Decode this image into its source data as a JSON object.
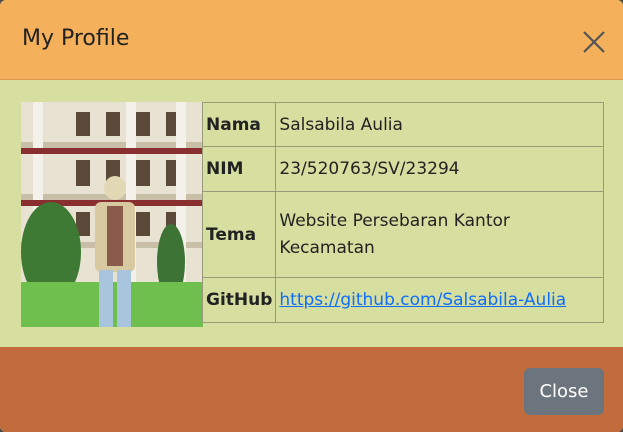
{
  "modal": {
    "title": "My Profile",
    "close_icon": "close-icon"
  },
  "profile": {
    "photo_alt": "profile-photo",
    "rows": [
      {
        "key": "Nama",
        "value": "Salsabila Aulia"
      },
      {
        "key": "NIM",
        "value": "23/520763/SV/23294"
      },
      {
        "key": "Tema",
        "value": "Website Persebaran Kantor Kecamatan"
      },
      {
        "key": "GitHub",
        "value": "https://github.com/Salsabila-Aulia"
      }
    ]
  },
  "footer": {
    "close_label": "Close"
  },
  "colors": {
    "header": "#f4b05b",
    "body": "#d7dfa0",
    "footer": "#c26b3c",
    "button": "#6c757d",
    "link": "#0d6efd"
  }
}
